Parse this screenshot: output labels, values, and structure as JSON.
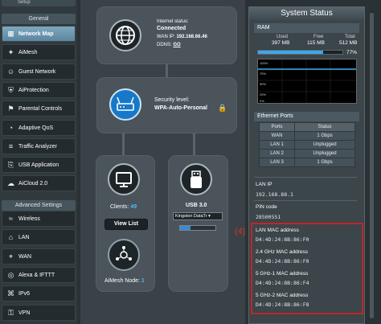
{
  "sidebar": {
    "top_label": "Setup",
    "general_header": "General",
    "advanced_header": "Advanced Settings",
    "general_items": [
      {
        "label": "Network Map",
        "icon": "network-map-icon",
        "active": true
      },
      {
        "label": "AiMesh",
        "icon": "aimesh-icon"
      },
      {
        "label": "Guest Network",
        "icon": "guest-network-icon"
      },
      {
        "label": "AiProtection",
        "icon": "aiprotection-icon"
      },
      {
        "label": "Parental Controls",
        "icon": "parental-controls-icon"
      },
      {
        "label": "Adaptive QoS",
        "icon": "adaptive-qos-icon"
      },
      {
        "label": "Traffic Analyzer",
        "icon": "traffic-analyzer-icon"
      },
      {
        "label": "USB Application",
        "icon": "usb-application-icon"
      },
      {
        "label": "AiCloud 2.0",
        "icon": "aicloud-icon"
      }
    ],
    "advanced_items": [
      {
        "label": "Wireless",
        "icon": "wireless-icon"
      },
      {
        "label": "LAN",
        "icon": "lan-icon"
      },
      {
        "label": "WAN",
        "icon": "wan-icon"
      },
      {
        "label": "Alexa & IFTTT",
        "icon": "alexa-icon"
      },
      {
        "label": "IPv6",
        "icon": "ipv6-icon"
      },
      {
        "label": "VPN",
        "icon": "vpn-icon"
      }
    ]
  },
  "map": {
    "internet_status_label": "Internet status:",
    "internet_status_value": "Connected",
    "wan_ip_label": "WAN IP:",
    "wan_ip_value": "192.168.66.46",
    "ddns_label": "DDNS:",
    "ddns_value": "GO",
    "security_label": "Security level:",
    "security_value": "WPA-Auto-Personal",
    "clients_label": "Clients:",
    "clients_count": "49",
    "view_list_label": "View List",
    "aimesh_label": "AiMesh Node:",
    "aimesh_count": "1",
    "usb_label": "USB 3.0",
    "usb_device": "Kingston DataTr"
  },
  "status": {
    "title": "System Status",
    "ram": {
      "header": "RAM",
      "used_label": "Used",
      "free_label": "Free",
      "total_label": "Total",
      "used_value": "397 MB",
      "free_value": "115 MB",
      "total_value": "512 MB",
      "percent": "77%",
      "fill_fraction": 0.77
    },
    "graph_labels": [
      "100%",
      "75%",
      "50%",
      "25%",
      "0%"
    ],
    "ethernet": {
      "header": "Ethernet Ports",
      "col_ports": "Ports",
      "col_status": "Status",
      "rows": [
        {
          "port": "WAN",
          "status": "1 Gbps"
        },
        {
          "port": "LAN 1",
          "status": "Unplugged"
        },
        {
          "port": "LAN 2",
          "status": "Unplugged"
        },
        {
          "port": "LAN 3",
          "status": "1 Gbps"
        }
      ]
    },
    "lan_ip_label": "LAN IP",
    "lan_ip_value": "192.168.88.1",
    "pin_label": "PIN code",
    "pin_value": "28500551",
    "lan_mac_label": "LAN MAC address",
    "lan_mac_value": "D4:4D:24:8B:86:F0",
    "g24_mac_label": "2.4 GHz MAC address",
    "g24_mac_value": "D4:4D:24:8B:86:F0",
    "g5_1_mac_label": "5 GHz-1 MAC address",
    "g5_1_mac_value": "D4:4D:24:8B:86:F4",
    "g5_2_mac_label": "5 GHz-2 MAC address",
    "g5_2_mac_value": "D4:4D:24:8B:86:F8",
    "highlight_number": "(4)",
    "highlight_color": "#c0262a"
  }
}
